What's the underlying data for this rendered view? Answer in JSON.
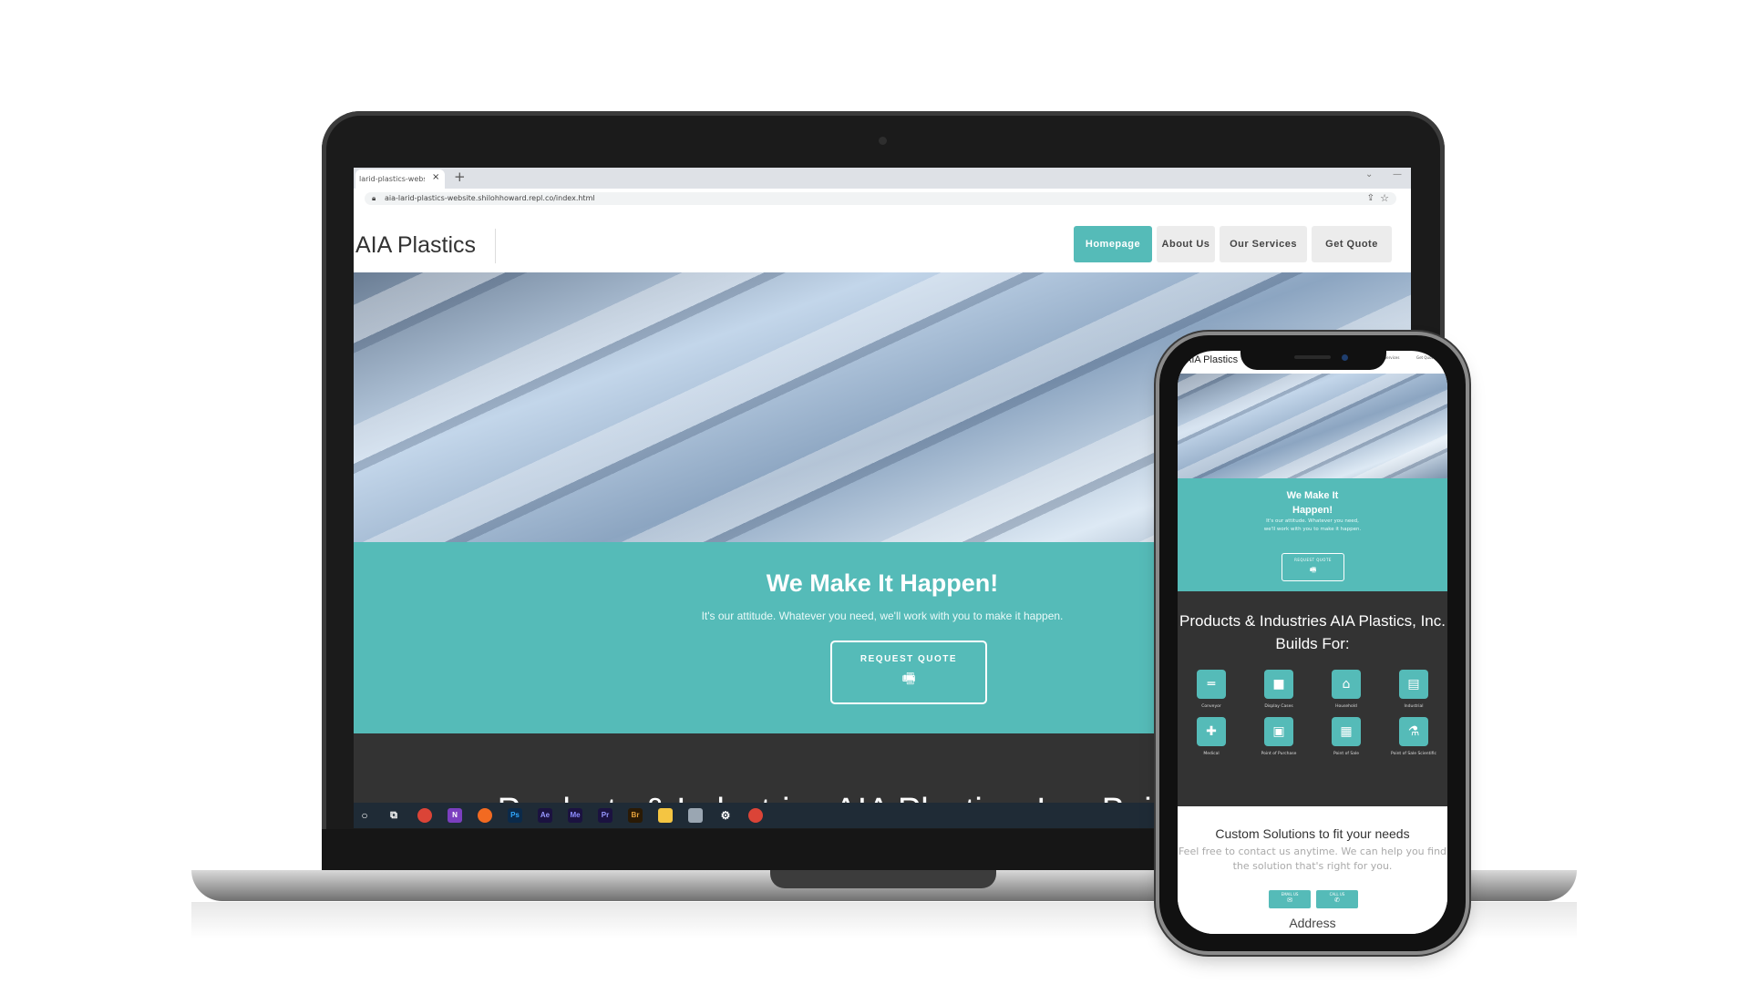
{
  "browser": {
    "tab_title": "larid-plastics-website",
    "tab_close": "×",
    "new_tab": "+",
    "url": "aia-larid-plastics-website.shilohhoward.repl.co/index.html"
  },
  "site": {
    "logo": "AIA Plastics",
    "nav": [
      "Homepage",
      "About Us",
      "Our Services",
      "Get Quote"
    ],
    "active_nav": "Homepage",
    "hero_title": "We Make It Happen!",
    "hero_subtitle": "It's our attitude. Whatever you need, we'll work with you to make it happen.",
    "cta_label": "REQUEST QUOTE",
    "products_heading": "Products & Industries AIA Plastics, Inc. Builds For:",
    "custom_heading": "Custom Solutions to fit your needs",
    "custom_sub_line1": "Feel free to contact us anytime. We can help you find",
    "custom_sub_line2": "the solution that's right for you.",
    "address_heading": "Address",
    "mobile_hero_sub": "It's our attitude. Whatever you need, we'll work with you to make it happen.",
    "email_label": "EMAIL US",
    "call_label": "CALL US",
    "industries": [
      {
        "label": "Conveyor",
        "icon": "conveyor-icon"
      },
      {
        "label": "Display Cases",
        "icon": "display-case-icon"
      },
      {
        "label": "Household",
        "icon": "home-icon"
      },
      {
        "label": "Industrial",
        "icon": "building-icon"
      },
      {
        "label": "Medical",
        "icon": "medical-icon"
      },
      {
        "label": "Point of Purchase",
        "icon": "store-icon"
      },
      {
        "label": "Point of Sale",
        "icon": "register-icon"
      },
      {
        "label": "Point of Sale Scientific",
        "icon": "flask-icon"
      }
    ]
  },
  "colors": {
    "accent": "#55bbb8",
    "dark_section": "#333333",
    "nav_inactive": "#ececec"
  },
  "taskbar_icons": [
    "search-circle-icon",
    "task-view-icon",
    "chrome-icon",
    "onenote-icon",
    "firefox-icon",
    "photoshop-icon",
    "after-effects-icon",
    "media-encoder-icon",
    "premiere-icon",
    "bridge-icon",
    "file-explorer-icon",
    "printer-icon",
    "settings-icon",
    "chrome-alt-icon"
  ]
}
